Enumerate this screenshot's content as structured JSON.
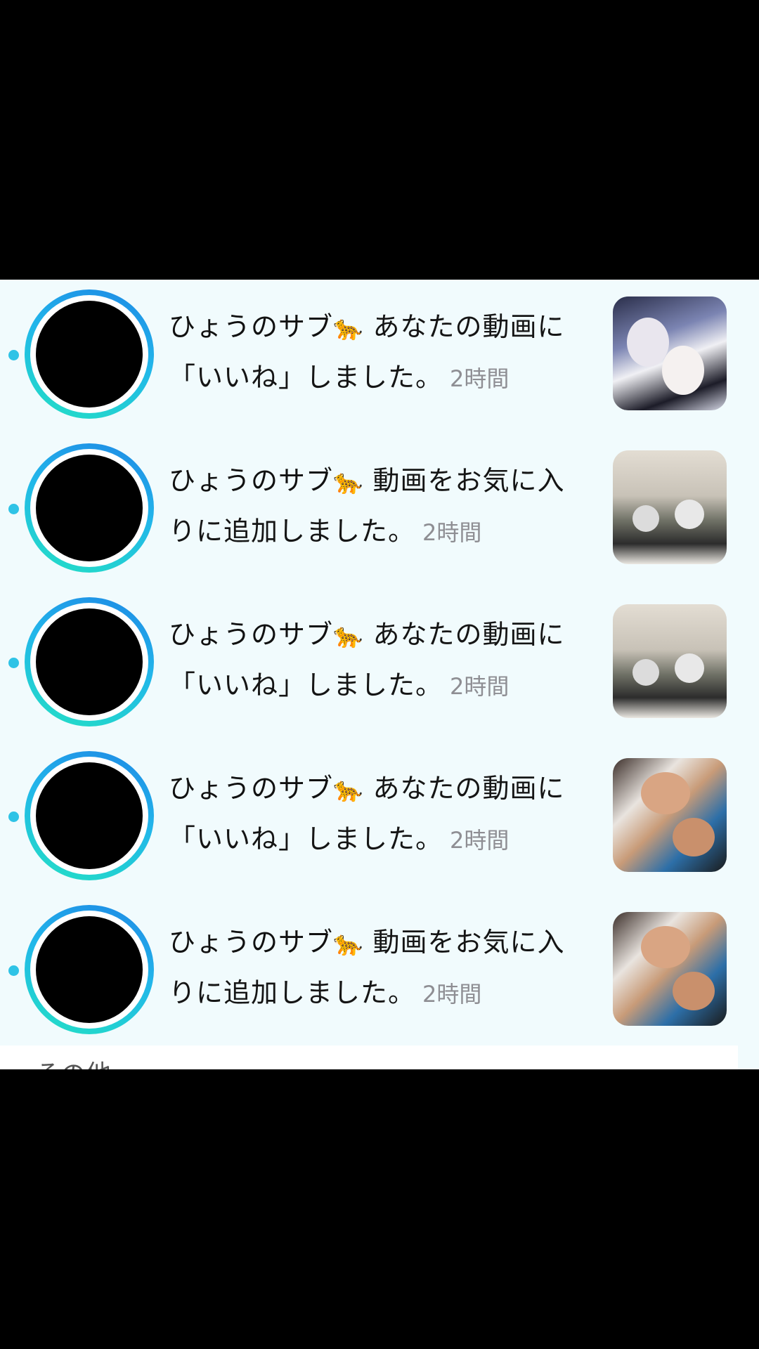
{
  "notifications": [
    {
      "user": "ひょうのサブ",
      "emoji": "🐆",
      "message": "あなたの動画に「いいね」しました。",
      "time": "2時間"
    },
    {
      "user": "ひょうのサブ",
      "emoji": "🐆",
      "message": "動画をお気に入りに追加しました。",
      "time": "2時間"
    },
    {
      "user": "ひょうのサブ",
      "emoji": "🐆",
      "message": "あなたの動画に「いいね」しました。",
      "time": "2時間"
    },
    {
      "user": "ひょうのサブ",
      "emoji": "🐆",
      "message": "あなたの動画に「いいね」しました。",
      "time": "2時間"
    },
    {
      "user": "ひょうのサブ",
      "emoji": "🐆",
      "message": "動画をお気に入りに追加しました。",
      "time": "2時間"
    }
  ],
  "footer": {
    "section_label": "その他"
  },
  "colors": {
    "ring_start": "#1e88e5",
    "ring_end": "#23e0c4",
    "unread_dot": "#2fc3e6",
    "panel_bg": "#f1fbfd"
  }
}
